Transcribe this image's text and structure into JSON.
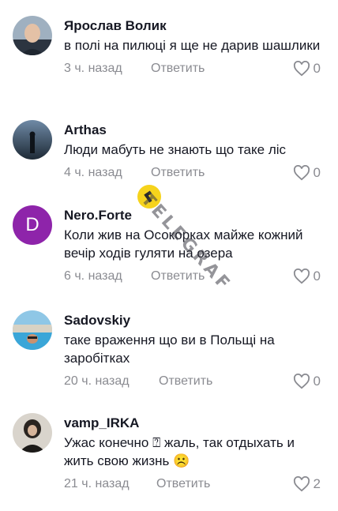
{
  "comments": [
    {
      "username": "Ярослав Волик",
      "text": "в полі на пилюці я ще не дарив шашлики",
      "time": "3 ч. назад",
      "reply_label": "Ответить",
      "likes": "0",
      "avatar": "avatar-man-bald"
    },
    {
      "username": "Arthas",
      "text": "Люди мабуть не знають що таке ліс",
      "time": "4 ч. назад",
      "reply_label": "Ответить",
      "likes": "0",
      "avatar": "avatar-silhouette-dusk"
    },
    {
      "username": "Nero.Forte",
      "text": "Коли жив на Осокорках майже кожний вечір ходів гуляти на озера",
      "time": "6 ч. назад",
      "reply_label": "Ответить",
      "likes": "0",
      "avatar": "avatar-letter",
      "avatar_letter": "D",
      "avatar_color": "#8e24aa"
    },
    {
      "username": "Sadovskiy",
      "text": "таке враження що ви в Польщі на заробітках",
      "time": "20 ч. назад",
      "reply_label": "Ответить",
      "likes": "0",
      "avatar": "avatar-pool-beach"
    },
    {
      "username": "vamp_IRKA",
      "text": "Ужас конечно ⍰ жаль, так отдыхать и жить свою жизнь ☹️",
      "time": "21 ч. назад",
      "reply_label": "Ответить",
      "likes": "2",
      "avatar": "avatar-woman-dark"
    }
  ],
  "watermark": {
    "text": "TELEGRAF",
    "color": "#f6d31c"
  },
  "colors": {
    "username": "#161823",
    "text": "#161823",
    "muted": "#8a8b91"
  }
}
